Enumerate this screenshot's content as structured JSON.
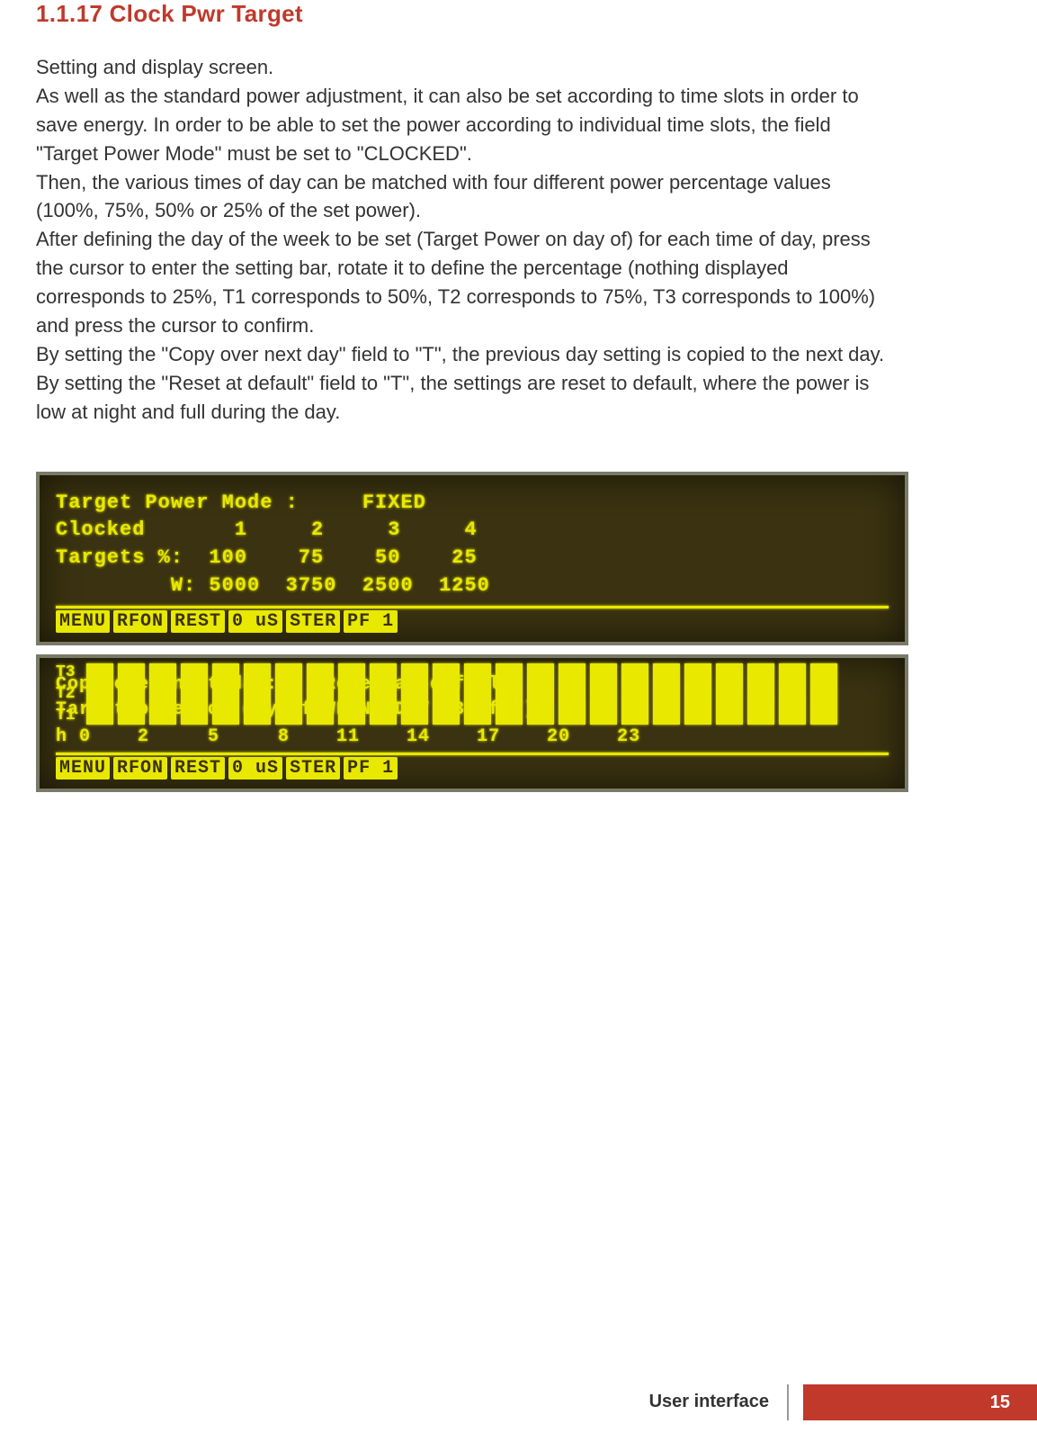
{
  "heading": "1.1.17 Clock Pwr Target",
  "paragraphs": [
    "Setting and display screen.",
    "As well as the standard power adjustment, it can also be set according to time slots in order to save energy. In order to be able to set the power according to individual time slots, the field \"Target Power Mode\" must be set to \"CLOCKED\".",
    "Then, the various times of day can be matched with four different power percentage values (100%, 75%, 50% or 25% of the set power).",
    "After defining the day of the week to be set (Target Power on day of) for each time of day, press the cursor to enter the setting bar, rotate it to define the percentage (nothing displayed corresponds to 25%, T1 corresponds to 50%, T2 corresponds to 75%, T3 corresponds to 100%) and press the cursor to confirm.",
    "By setting the \"Copy over next day\" field to \"T\", the previous day setting is copied to the next day.",
    "By setting the \"Reset at default\" field to \"T\", the settings are reset to default, where the power is low at night and full during the day."
  ],
  "lcd1": {
    "line1": "Target Power Mode :     FIXED",
    "line2": "Clocked       1     2     3     4",
    "line3": "Targets %:  100    75    50    25",
    "line4": "         W: 5000  3750  2500  1250",
    "menu": [
      "MENU",
      "RFON",
      "REST",
      "0 uS",
      "STER",
      "PF  1"
    ]
  },
  "lcd2": {
    "line1": "Copy over next day: F  Reset at default: F",
    "line2": "Target power on day of WEDNESDAY (3 of 7)",
    "tiers": [
      "T3",
      "T2",
      "T1"
    ],
    "hours": "h 0    2     5     8    11    14    17    20    23",
    "bars": [
      3,
      3,
      3,
      3,
      3,
      3,
      3,
      3,
      3,
      3,
      3,
      3,
      3,
      3,
      3,
      3,
      3,
      3,
      3,
      3,
      3,
      3,
      3,
      3
    ],
    "menu": [
      "MENU",
      "RFON",
      "REST",
      "0 uS",
      "STER",
      "PF  1"
    ]
  },
  "footer": {
    "section": "User interface",
    "page": "15"
  }
}
